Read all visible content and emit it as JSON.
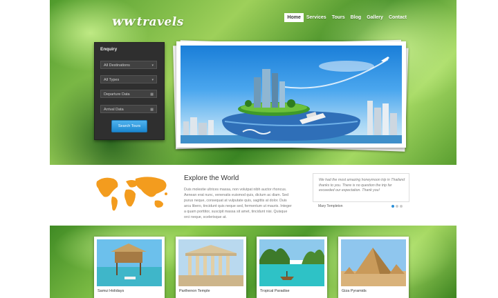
{
  "logo": {
    "mark": "ᴡᴡ",
    "text": "travels"
  },
  "nav": [
    {
      "label": "Home",
      "active": true
    },
    {
      "label": "Services",
      "active": false
    },
    {
      "label": "Tours",
      "active": false
    },
    {
      "label": "Blog",
      "active": false
    },
    {
      "label": "Gallery",
      "active": false
    },
    {
      "label": "Contact",
      "active": false
    }
  ],
  "enquiry": {
    "title": "Enquiry",
    "destinations": "All Destinations",
    "types": "All Types",
    "departure_placeholder": "Departure Data",
    "arrival_placeholder": "Arrival Data",
    "search_label": "Search Tours"
  },
  "intro": {
    "title": "Explore the World",
    "text": "Duis molestie ultrices massa, non volutpat nibh auctor rhoncus. Aenean erat nunc, venenatis euismod quis, dictum ac diam. Sed purus neque, consequat at vulputate quis, sagittis at dolor. Duis arcu libero, tincidunt quis neque sed, fermentum ut mauris. Integer a quam porttitor, suscipit massa sit amet, tincidunt nisi. Quisque orci neque, scelerisque at."
  },
  "testimonial": {
    "quote": "We had the most amazing honeymoon trip in Thailand thanks to you. There is no question the trip far exceeded our expectation. Thank you!",
    "author": "Mary Templeton"
  },
  "destinations": [
    {
      "label": "Samui Holidays"
    },
    {
      "label": "Parthenon Temple"
    },
    {
      "label": "Tropical Paradise"
    },
    {
      "label": "Giza Pyramids"
    }
  ],
  "colors": {
    "accent": "#2a8fd8",
    "map": "#f39c1e",
    "dark_panel": "#2f2f2f"
  }
}
